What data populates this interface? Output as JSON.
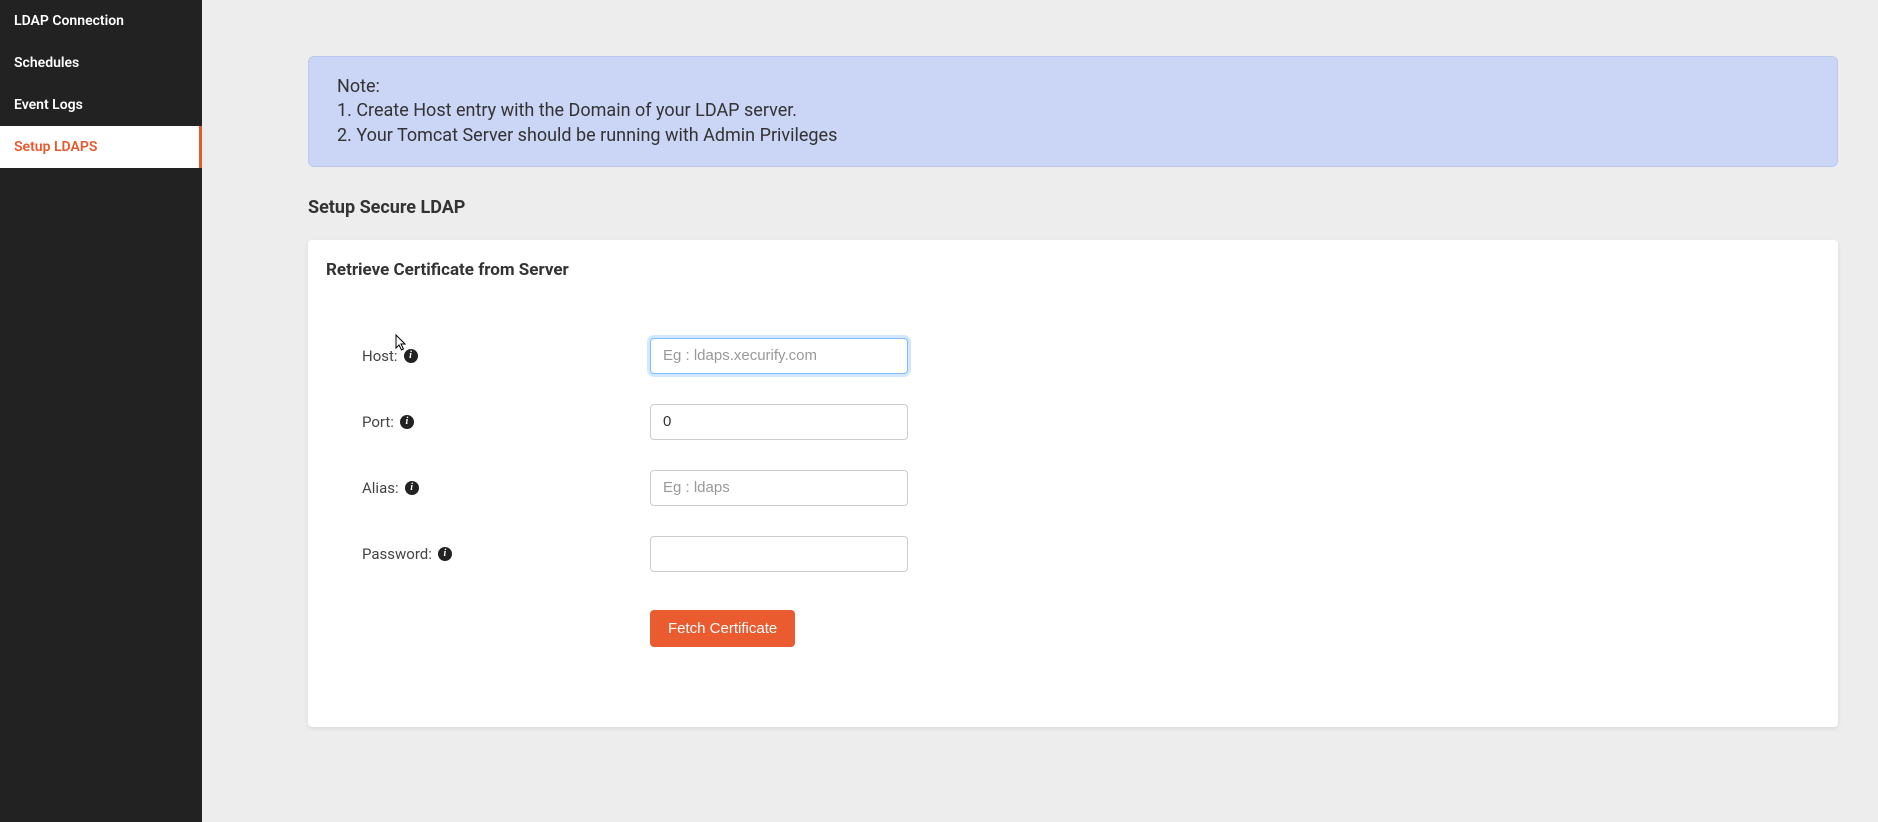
{
  "sidebar": {
    "items": [
      {
        "label": "LDAP Connection",
        "active": false
      },
      {
        "label": "Schedules",
        "active": false
      },
      {
        "label": "Event Logs",
        "active": false
      },
      {
        "label": "Setup LDAPS",
        "active": true
      }
    ]
  },
  "note": {
    "heading": "Note:",
    "line1": "1. Create Host entry with the Domain of your LDAP server.",
    "line2": "2. Your Tomcat Server should be running with Admin Privileges"
  },
  "page_title": "Setup Secure LDAP",
  "card_title": "Retrieve Certificate from Server",
  "form": {
    "host": {
      "label": "Host:",
      "placeholder": "Eg : ldaps.xecurify.com",
      "value": ""
    },
    "port": {
      "label": "Port:",
      "value": "0"
    },
    "alias": {
      "label": "Alias:",
      "placeholder": "Eg : ldaps",
      "value": ""
    },
    "password": {
      "label": "Password:",
      "value": ""
    },
    "button": "Fetch Certificate"
  }
}
